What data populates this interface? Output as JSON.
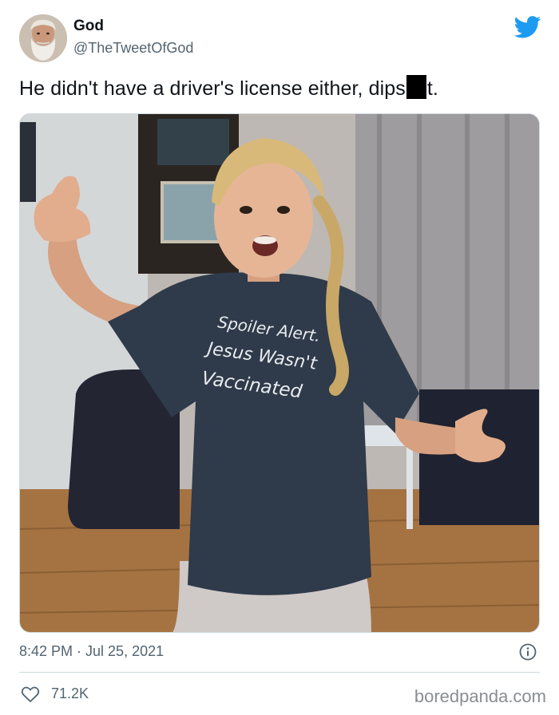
{
  "author": {
    "name": "God",
    "handle": "@TheTweetOfGod",
    "avatar_icon": "bearded-old-man-avatar"
  },
  "tweet": {
    "text_before": "He didn't have a driver's license either, dips",
    "text_after": "t.",
    "redaction_color": "#000000"
  },
  "photo": {
    "shirt_lines": [
      "Spoiler Alert.",
      "Jesus Wasn't",
      "Vaccinated"
    ]
  },
  "meta": {
    "timestamp": "8:42 PM · Jul 25, 2021",
    "info_icon": "info-icon"
  },
  "engagement": {
    "likes": "71.2K",
    "like_icon": "heart-icon"
  },
  "watermark": "boredpanda.com",
  "colors": {
    "twitter_blue": "#1d9bf0",
    "text": "#0f1419",
    "muted": "#536471"
  }
}
